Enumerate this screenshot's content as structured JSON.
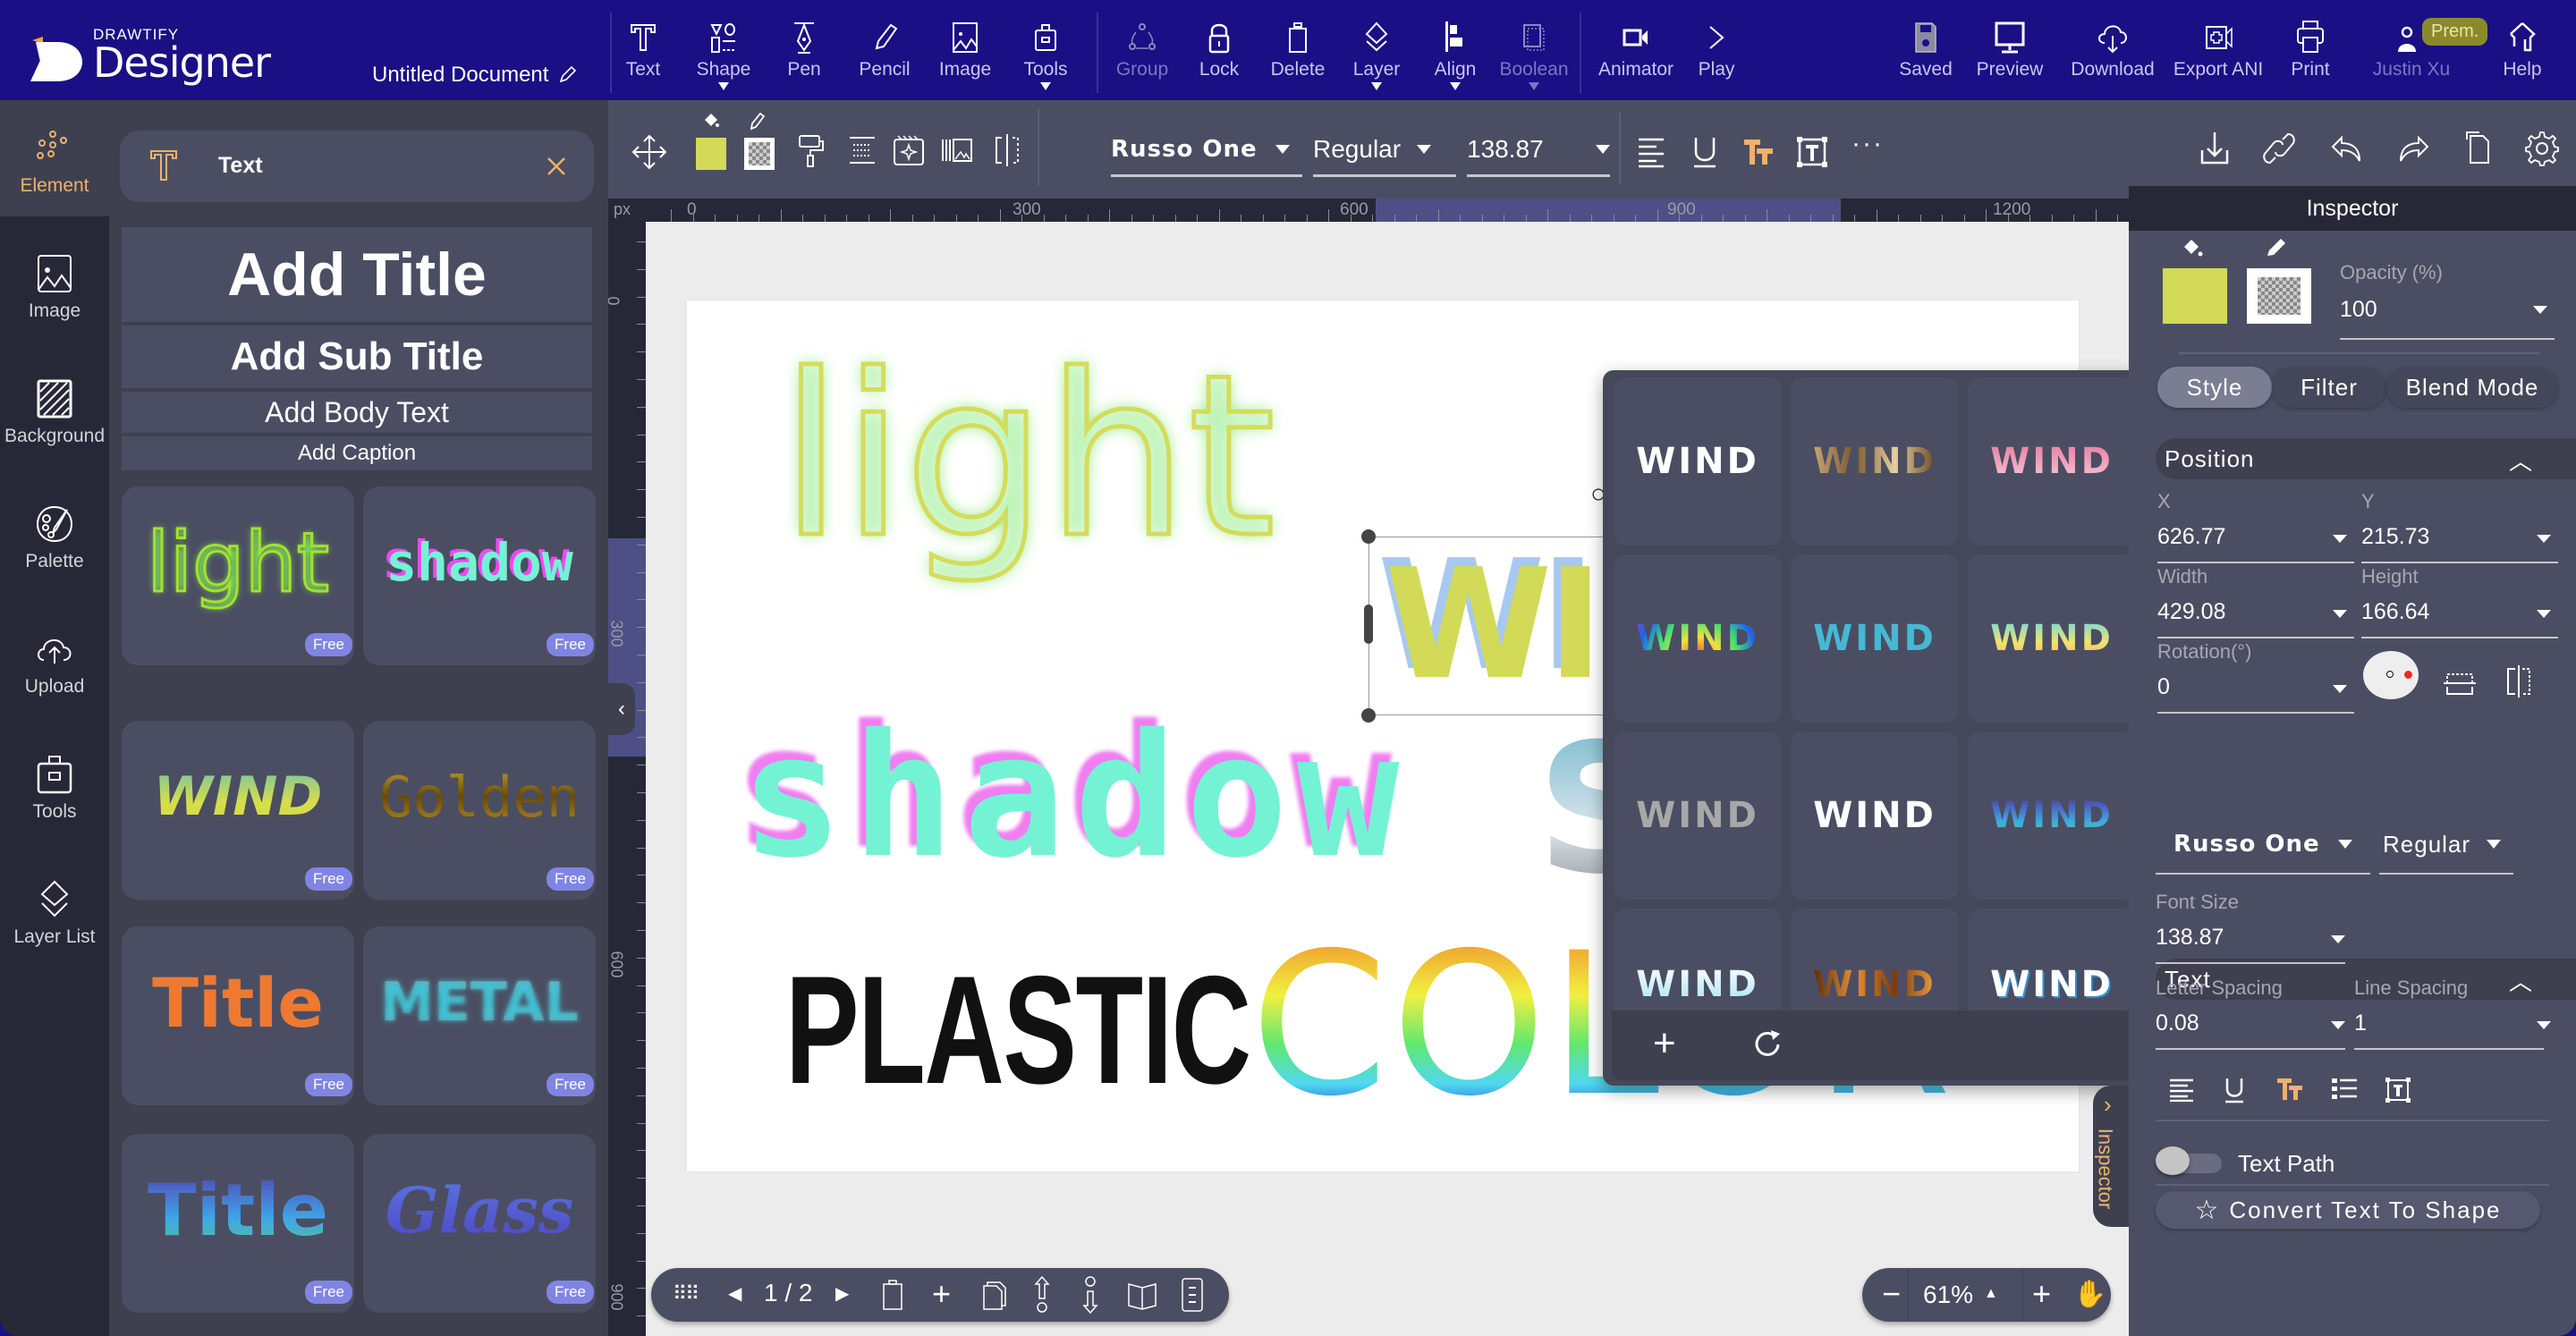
{
  "app": {
    "brand_small": "DRAWTIFY",
    "brand_big": "Designer",
    "document_title": "Untitled Document"
  },
  "topbar": {
    "left_tools": [
      {
        "label": "Text",
        "icon": "text-icon"
      },
      {
        "label": "Shape",
        "icon": "shape-icon",
        "dropdown": true
      },
      {
        "label": "Pen",
        "icon": "pen-icon"
      },
      {
        "label": "Pencil",
        "icon": "pencil-icon"
      },
      {
        "label": "Image",
        "icon": "image-icon"
      },
      {
        "label": "Tools",
        "icon": "tools-icon",
        "dropdown": true
      }
    ],
    "edit_tools": [
      {
        "label": "Group",
        "icon": "group-icon",
        "disabled": true
      },
      {
        "label": "Lock",
        "icon": "lock-icon"
      },
      {
        "label": "Delete",
        "icon": "delete-icon"
      },
      {
        "label": "Layer",
        "icon": "layer-icon",
        "dropdown": true
      },
      {
        "label": "Align",
        "icon": "align-icon",
        "dropdown": true
      },
      {
        "label": "Boolean",
        "icon": "boolean-icon",
        "disabled": true,
        "dropdown": true
      }
    ],
    "anim_tools": [
      {
        "label": "Animator",
        "icon": "animator-icon"
      },
      {
        "label": "Play",
        "icon": "play-icon"
      }
    ],
    "right_tools": [
      {
        "label": "Saved",
        "icon": "save-icon"
      },
      {
        "label": "Preview",
        "icon": "preview-icon"
      },
      {
        "label": "Download",
        "icon": "download-icon"
      },
      {
        "label": "Export ANI",
        "icon": "export-icon"
      },
      {
        "label": "Print",
        "icon": "print-icon"
      },
      {
        "label": "Justin Xu",
        "icon": "user-icon"
      },
      {
        "label": "Help",
        "icon": "help-icon"
      }
    ],
    "premium_badge": "Prem."
  },
  "rail": {
    "items": [
      {
        "label": "Element",
        "icon": "element-icon",
        "active": true
      },
      {
        "label": "Image",
        "icon": "image-icon"
      },
      {
        "label": "Background",
        "icon": "background-icon"
      },
      {
        "label": "Palette",
        "icon": "palette-icon"
      },
      {
        "label": "Upload",
        "icon": "upload-icon"
      },
      {
        "label": "Tools",
        "icon": "tools-icon"
      },
      {
        "label": "Layer List",
        "icon": "layer-list-icon"
      }
    ]
  },
  "left_panel": {
    "header": "Text",
    "add_title": "Add Title",
    "add_subtitle": "Add Sub Title",
    "add_body": "Add Body Text",
    "add_caption": "Add Caption",
    "templates": [
      {
        "text": "light",
        "badge": "Free"
      },
      {
        "text": "shadow",
        "badge": "Free"
      },
      {
        "text": "WIND",
        "badge": "Free"
      },
      {
        "text": "Golden",
        "badge": "Free"
      },
      {
        "text": "Title",
        "badge": "Free"
      },
      {
        "text": "METAL",
        "badge": "Free"
      },
      {
        "text": "Title",
        "badge": "Free"
      },
      {
        "text": "Glass",
        "badge": "Free"
      }
    ]
  },
  "toolbar": {
    "fill_color": "#d2da58",
    "font_family": "Russo One",
    "font_style": "Regular",
    "font_size": "138.87"
  },
  "ruler": {
    "unit": "px",
    "h_ticks": [
      "0",
      "300",
      "600",
      "900",
      "1200"
    ],
    "v_ticks": [
      "0",
      "300",
      "600",
      "900"
    ]
  },
  "canvas": {
    "texts": [
      "light",
      "WI",
      "shadow",
      "S",
      "PLASTIC",
      "COLOR"
    ]
  },
  "style_popup": {
    "items": [
      "WIND",
      "WIND",
      "WIND",
      "WIND",
      "WIND",
      "WIND",
      "WIND",
      "WIND",
      "WIND",
      "WIND",
      "WIND",
      "WIND"
    ]
  },
  "page_nav": {
    "page_indicator": "1 / 2"
  },
  "zoom": {
    "level": "61%"
  },
  "inspector": {
    "title": "Inspector",
    "opacity_label": "Opacity (%)",
    "opacity_value": "100",
    "tabs": [
      "Style",
      "Filter",
      "Blend Mode"
    ],
    "active_tab": "Style",
    "position": {
      "header": "Position",
      "x_label": "X",
      "x_value": "626.77",
      "y_label": "Y",
      "y_value": "215.73",
      "width_label": "Width",
      "width_value": "429.08",
      "height_label": "Height",
      "height_value": "166.64",
      "rotation_label": "Rotation(°)",
      "rotation_value": "0"
    },
    "text": {
      "header": "Text",
      "font_family": "Russo One",
      "font_style": "Regular",
      "font_size_label": "Font Size",
      "font_size_value": "138.87",
      "letter_spacing_label": "Letter Spacing",
      "letter_spacing_value": "0.08",
      "line_spacing_label": "Line Spacing",
      "line_spacing_value": "1"
    },
    "text_path_label": "Text Path",
    "text_path_on": false,
    "convert_label": "Convert Text To Shape",
    "side_tab": "Inspector"
  },
  "colors": {
    "topbar": "#1b0f85",
    "accent_orange": "#f1b16a",
    "free_badge": "#8085e3",
    "fill": "#d2da58"
  }
}
